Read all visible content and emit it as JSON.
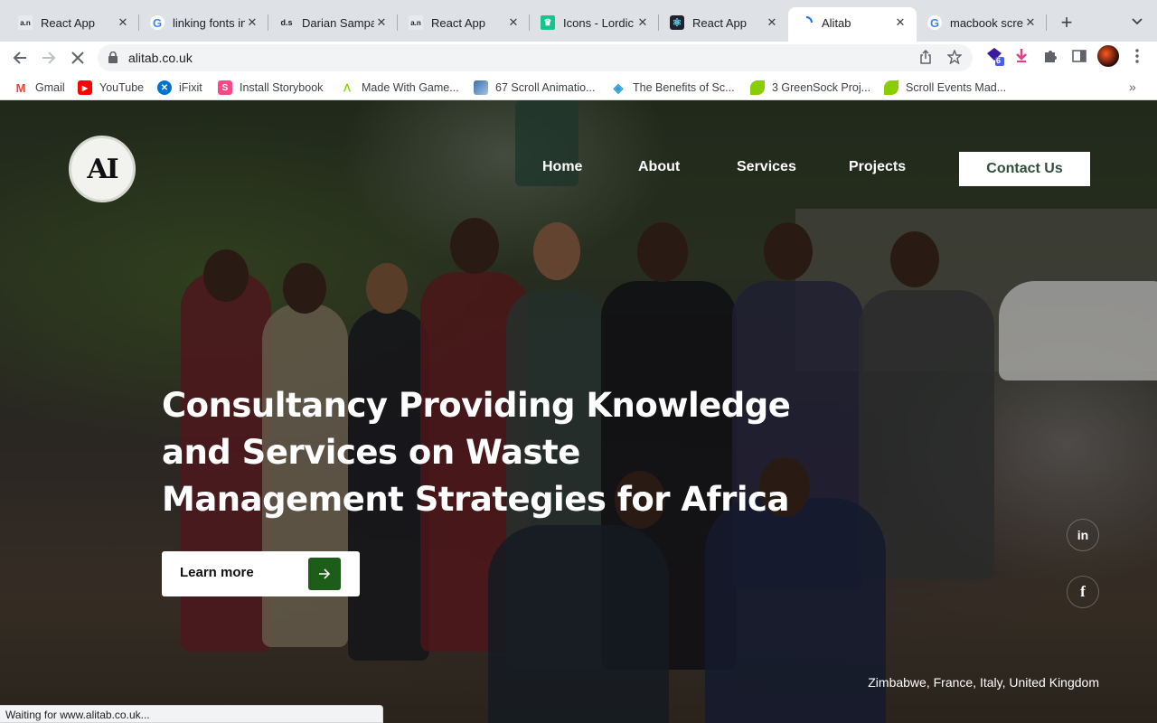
{
  "tabs": [
    {
      "title": "React App",
      "favicon": "a.n",
      "favicon_color": "#e8eaed"
    },
    {
      "title": "linking fonts in",
      "favicon": "G",
      "favicon_color": "#ffffff"
    },
    {
      "title": "Darian Sampa",
      "favicon": "d.s",
      "favicon_color": "#ffffff"
    },
    {
      "title": "React App",
      "favicon": "a.n",
      "favicon_color": "#e8eaed"
    },
    {
      "title": "Icons - Lordic",
      "favicon": "crown",
      "favicon_color": "#16c58e"
    },
    {
      "title": "React App",
      "favicon": "react",
      "favicon_color": "#20232a"
    },
    {
      "title": "Alitab",
      "favicon": "loading",
      "favicon_color": "#ffffff",
      "active": true
    },
    {
      "title": "macbook scre",
      "favicon": "G",
      "favicon_color": "#ffffff"
    }
  ],
  "toolbar": {
    "url": "alitab.co.uk",
    "profile_badge": "6"
  },
  "bookmarks": [
    {
      "label": "Gmail",
      "icon": "gmail-icon",
      "color": "#ea4335"
    },
    {
      "label": "YouTube",
      "icon": "youtube-icon",
      "color": "#ff0000"
    },
    {
      "label": "iFixit",
      "icon": "ifixit-icon",
      "color": "#0071ce"
    },
    {
      "label": "Install Storybook",
      "icon": "storybook-icon",
      "color": "#ff4785"
    },
    {
      "label": "Made With Game...",
      "icon": "gsap-icon",
      "color": "#88ce02"
    },
    {
      "label": "67 Scroll Animatio...",
      "icon": "bookmark-image-icon",
      "color": "#3b6ea5"
    },
    {
      "label": "The Benefits of Sc...",
      "icon": "diamond-icon",
      "color": "#2d9cdb"
    },
    {
      "label": "3 GreenSock Proj...",
      "icon": "greensock-icon",
      "color": "#88ce02"
    },
    {
      "label": "Scroll Events Mad...",
      "icon": "greensock-icon",
      "color": "#88ce02"
    }
  ],
  "site": {
    "logo_text": "AI",
    "nav": [
      "Home",
      "About",
      "Services",
      "Projects"
    ],
    "contact": "Contact Us",
    "hero_title": "Consultancy Providing Knowledge and Services on Waste Management Strategies for Africa",
    "cta": "Learn more",
    "social": [
      "in",
      "f"
    ],
    "countries": "Zimbabwe, France, Italy, United Kingdom",
    "accent": "#1e5c1a"
  },
  "status_text": "Waiting for www.alitab.co.uk..."
}
